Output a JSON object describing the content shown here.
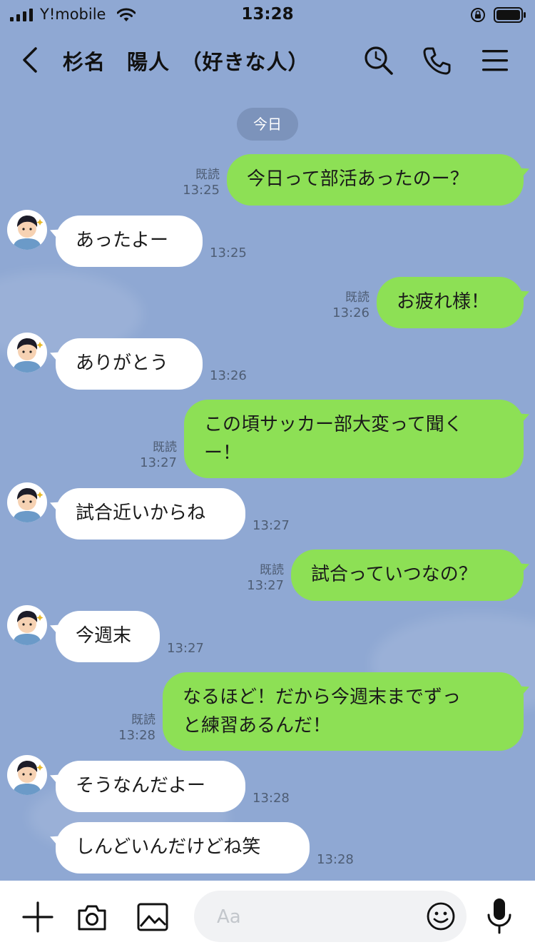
{
  "status_bar": {
    "carrier": "Y!mobile",
    "time": "13:28"
  },
  "header": {
    "title": "杉名　陽人　（好きな人）"
  },
  "date_label": "今日",
  "messages": [
    {
      "side": "out",
      "lines": [
        "今日って部活あったのー？"
      ],
      "read": "既読",
      "time": "13:25"
    },
    {
      "side": "in",
      "lines": [
        "あったよー"
      ],
      "time": "13:25"
    },
    {
      "side": "out",
      "lines": [
        "お疲れ様！"
      ],
      "read": "既読",
      "time": "13:26"
    },
    {
      "side": "in",
      "lines": [
        "ありがとう"
      ],
      "time": "13:26"
    },
    {
      "side": "out",
      "lines": [
        "この頃サッカー部大変って聞く",
        "ー！"
      ],
      "read": "既読",
      "time": "13:27"
    },
    {
      "side": "in",
      "lines": [
        "試合近いからね"
      ],
      "time": "13:27"
    },
    {
      "side": "out",
      "lines": [
        "試合っていつなの？"
      ],
      "read": "既読",
      "time": "13:27"
    },
    {
      "side": "in",
      "lines": [
        "今週末"
      ],
      "time": "13:27"
    },
    {
      "side": "out",
      "lines": [
        "なるほど！だから今週末までずっ",
        "と練習あるんだ！"
      ],
      "read": "既読",
      "time": "13:28"
    },
    {
      "side": "in",
      "lines": [
        "そうなんだよー"
      ],
      "time": "13:28"
    },
    {
      "side": "in",
      "lines": [
        "しんどいんだけどね笑"
      ],
      "time": "13:28",
      "no_avatar": true
    }
  ],
  "input": {
    "placeholder": "Aa"
  },
  "icons": {
    "back": "chevron-left-icon",
    "search": "search-icon",
    "call": "phone-icon",
    "menu": "menu-icon",
    "plus": "plus-icon",
    "camera": "camera-icon",
    "image": "image-icon",
    "emoji": "emoji-icon",
    "mic": "microphone-icon"
  },
  "colors": {
    "background": "#8fa8d3",
    "outgoing_bubble": "#8de055",
    "incoming_bubble": "#ffffff"
  }
}
